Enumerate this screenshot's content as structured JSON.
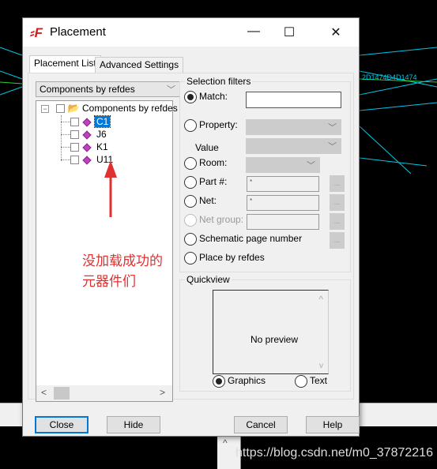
{
  "window": {
    "title": "Placement",
    "minimize": "—",
    "maximize": "☐",
    "close": "✕",
    "app_icon": "allegro-logo-icon"
  },
  "tabs": [
    {
      "label": "Placement List",
      "active": true
    },
    {
      "label": "Advanced Settings",
      "active": false
    }
  ],
  "list_type": {
    "selected": "Components by refdes"
  },
  "tree": {
    "root": "Components by refdes",
    "items": [
      {
        "label": "C1",
        "selected": true
      },
      {
        "label": "J6"
      },
      {
        "label": "K1"
      },
      {
        "label": "U11"
      }
    ]
  },
  "filters": {
    "title": "Selection filters",
    "match": "Match:",
    "match_value": "",
    "property": "Property:",
    "value": "Value",
    "room": "Room:",
    "part": "Part #:",
    "part_value": "*",
    "net": "Net:",
    "net_value": "*",
    "net_group": "Net group:",
    "schematic": "Schematic page number",
    "place_by_refdes": "Place by refdes",
    "dots": "..."
  },
  "quickview": {
    "title": "Quickview",
    "preview": "No preview",
    "graphics": "Graphics",
    "text": "Text",
    "selected": "Graphics"
  },
  "buttons": {
    "close": "Close",
    "hide": "Hide",
    "cancel": "Cancel",
    "help": "Help"
  },
  "annotation": {
    "line1": "没加载成功的",
    "line2": "元器件们",
    "color": "#e03030"
  },
  "watermark": "https://blog.csdn.net/m0_37872216"
}
